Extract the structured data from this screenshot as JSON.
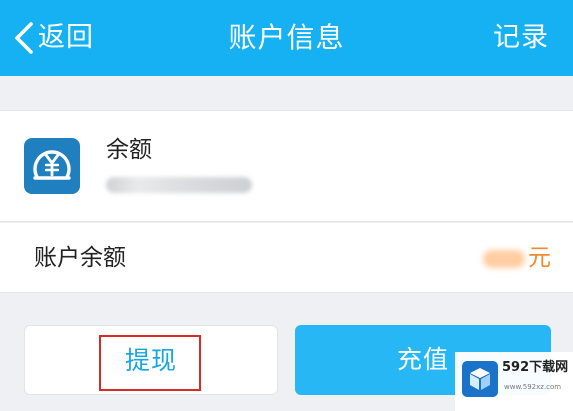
{
  "header": {
    "back_label": "返回",
    "title": "账户信息",
    "right_action": "记录"
  },
  "balance_card": {
    "title": "余额",
    "icon": "wallet-yuan-icon"
  },
  "account_row": {
    "label": "账户余额",
    "unit": "元"
  },
  "buttons": {
    "withdraw": "提现",
    "recharge": "充值"
  },
  "watermark": {
    "title": "592下载网",
    "subtitle": "www.592xz.com",
    "icon": "download-box-icon"
  },
  "colors": {
    "header_bg": "#16b1f3",
    "accent_text": "#18a6dc",
    "recharge_bg": "#26b7f4",
    "wallet_icon_bg": "#1f7fbf",
    "highlight": "#d92a2a",
    "amount_unit": "#f08a2c"
  }
}
